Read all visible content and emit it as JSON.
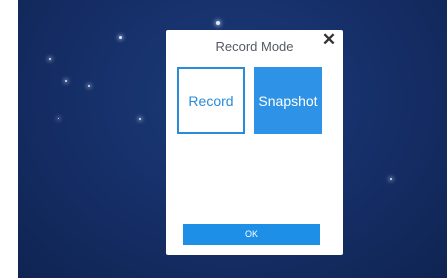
{
  "dialog": {
    "title": "Record Mode",
    "close_icon": "close-icon",
    "options": {
      "record_label": "Record",
      "snapshot_label": "Snapshot",
      "selected": "Snapshot"
    },
    "ok_label": "OK"
  },
  "colors": {
    "background": "#16306a",
    "accent": "#2e93e6"
  }
}
